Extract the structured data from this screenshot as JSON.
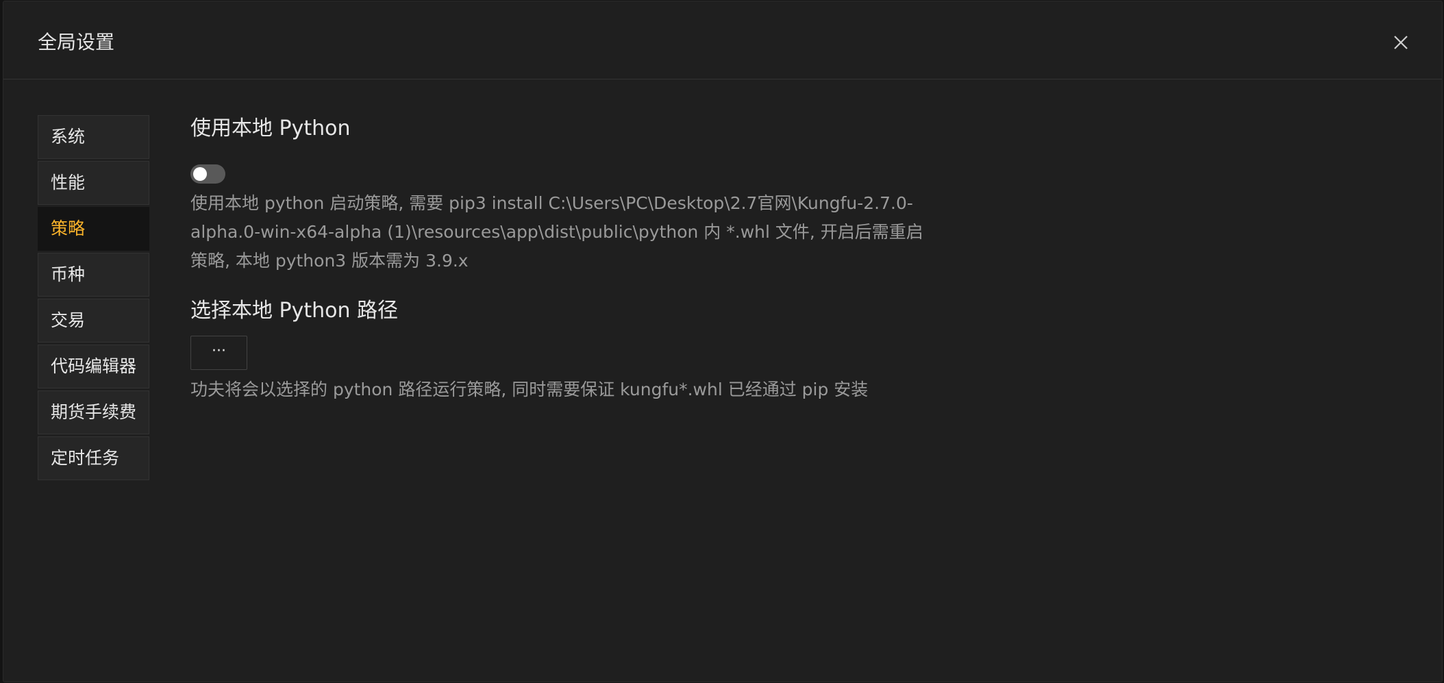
{
  "modal": {
    "title": "全局设置"
  },
  "sidebar": {
    "items": [
      {
        "label": "系统"
      },
      {
        "label": "性能"
      },
      {
        "label": "策略"
      },
      {
        "label": "币种"
      },
      {
        "label": "交易"
      },
      {
        "label": "代码编辑器"
      },
      {
        "label": "期货手续费"
      },
      {
        "label": "定时任务"
      }
    ],
    "active_index": 2
  },
  "strategy": {
    "use_local_python": {
      "title": "使用本地 Python",
      "enabled": false,
      "description_lines": [
        "使用本地 python 启动策略, 需要 pip3 install C:\\Users\\PC\\Desktop\\2.7官网\\Kungfu-2.7.0-",
        "alpha.0-win-x64-alpha (1)\\resources\\app\\dist\\public\\python 内 *.whl 文件, 开启后需重启",
        "策略, 本地 python3 版本需为 3.9.x"
      ]
    },
    "python_path": {
      "title": "选择本地 Python 路径",
      "button_label": "···",
      "description": "功夫将会以选择的 python 路径运行策略, 同时需要保证 kungfu*.whl 已经通过 pip 安装"
    }
  },
  "colors": {
    "accent": "#fab32a",
    "background": "#1f1f1f"
  },
  "icons": {
    "close": "close-icon"
  }
}
